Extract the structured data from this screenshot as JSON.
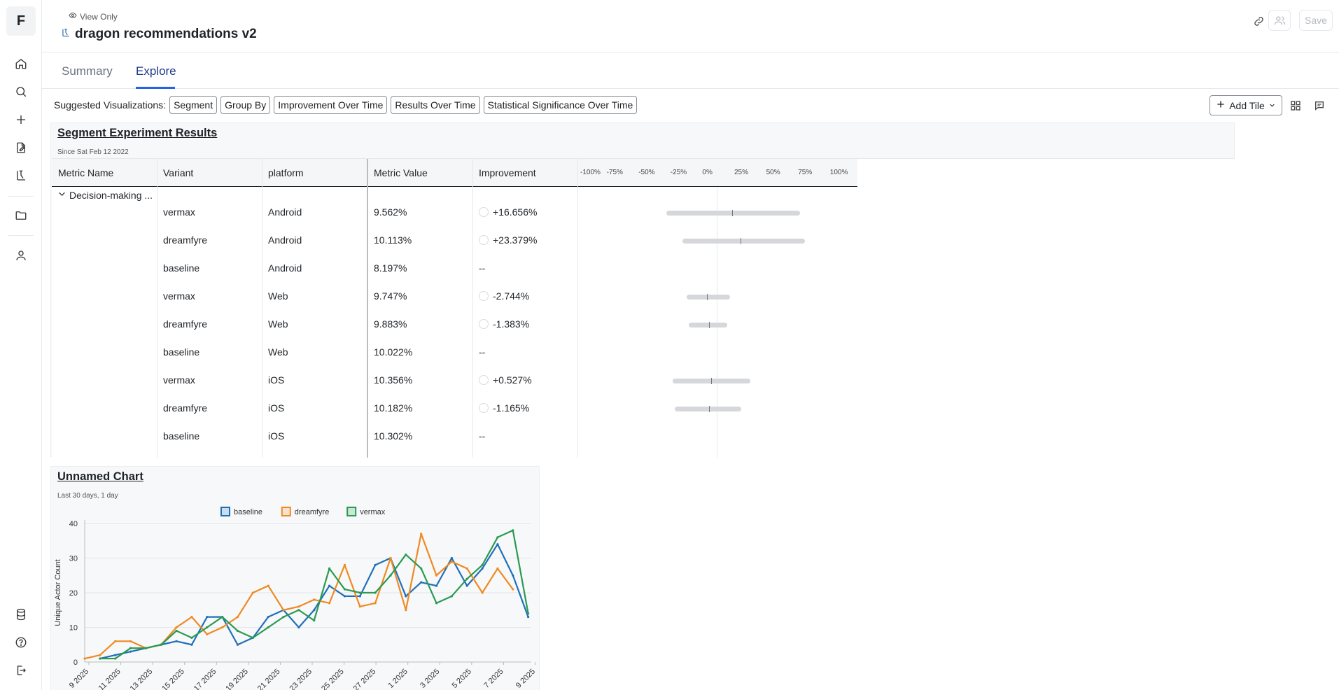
{
  "app": {
    "logo_letter": "F"
  },
  "header": {
    "view_only": "View Only",
    "title": "dragon recommendations v2",
    "save_label": "Save"
  },
  "tabs": [
    {
      "label": "Summary",
      "active": false
    },
    {
      "label": "Explore",
      "active": true
    }
  ],
  "toolbar": {
    "suggested_label": "Suggested Visualizations:",
    "chips": [
      "Segment",
      "Group By",
      "Improvement Over Time",
      "Results Over Time",
      "Statistical Significance Over Time"
    ],
    "add_tile_label": "Add Tile"
  },
  "segment_tile": {
    "title": "Segment Experiment Results",
    "subtitle": "Since Sat Feb 12 2022",
    "columns": [
      "Metric Name",
      "Variant",
      "platform",
      "Metric Value",
      "Improvement"
    ],
    "axis_ticks": [
      "-100%",
      "-75%",
      "-50%",
      "-25%",
      "0%",
      "25%",
      "50%",
      "75%",
      "100%"
    ],
    "group_label": "Decision-making ...",
    "rows": [
      {
        "variant": "vermax",
        "platform": "Android",
        "value": "9.562%",
        "improvement": "+16.656%",
        "imp_pct": 16.656,
        "ci_low": -35,
        "ci_high": 70
      },
      {
        "variant": "dreamfyre",
        "platform": "Android",
        "value": "10.113%",
        "improvement": "+23.379%",
        "imp_pct": 23.379,
        "ci_low": -22,
        "ci_high": 74
      },
      {
        "variant": "baseline",
        "platform": "Android",
        "value": "8.197%",
        "improvement": "--"
      },
      {
        "variant": "vermax",
        "platform": "Web",
        "value": "9.747%",
        "improvement": "-2.744%",
        "imp_pct": -2.744,
        "ci_low": -19,
        "ci_high": 15
      },
      {
        "variant": "dreamfyre",
        "platform": "Web",
        "value": "9.883%",
        "improvement": "-1.383%",
        "imp_pct": -1.383,
        "ci_low": -17,
        "ci_high": 13
      },
      {
        "variant": "baseline",
        "platform": "Web",
        "value": "10.022%",
        "improvement": "--"
      },
      {
        "variant": "vermax",
        "platform": "iOS",
        "value": "10.356%",
        "improvement": "+0.527%",
        "imp_pct": 0.527,
        "ci_low": -30,
        "ci_high": 31
      },
      {
        "variant": "dreamfyre",
        "platform": "iOS",
        "value": "10.182%",
        "improvement": "-1.165%",
        "imp_pct": -1.165,
        "ci_low": -28,
        "ci_high": 24
      },
      {
        "variant": "baseline",
        "platform": "iOS",
        "value": "10.302%",
        "improvement": "--"
      }
    ]
  },
  "chart_tile": {
    "title": "Unnamed Chart",
    "subtitle": "Last 30 days, 1 day"
  },
  "chart_data": {
    "type": "line",
    "ylabel": "Unique Actor Count",
    "xlabel": "",
    "ylim": [
      0,
      40
    ],
    "yticks": [
      0,
      10,
      20,
      30,
      40
    ],
    "x_tick_labels": [
      "9 2025",
      "11 2025",
      "13 2025",
      "15 2025",
      "17 2025",
      "19 2025",
      "21 2025",
      "23 2025",
      "25 2025",
      "27 2025",
      "1 2025",
      "3 2025",
      "5 2025",
      "7 2025",
      "9 2025"
    ],
    "grid": true,
    "legend_position": "top",
    "series": [
      {
        "name": "baseline",
        "color": "#1f6fb8",
        "values": [
          1,
          2,
          3,
          4,
          5,
          6,
          5,
          13,
          13,
          5,
          7,
          13,
          15,
          10,
          15,
          22,
          19,
          19,
          28,
          30,
          19,
          23,
          22,
          30,
          22,
          27,
          34,
          25,
          13
        ]
      },
      {
        "name": "dreamfyre",
        "color": "#ef8a22",
        "values": [
          1,
          2,
          6,
          6,
          4,
          5,
          10,
          13,
          8,
          10,
          13,
          20,
          22,
          15,
          16,
          18,
          17,
          28,
          16,
          17,
          30,
          15,
          37,
          25,
          29,
          27,
          20,
          27,
          21
        ]
      },
      {
        "name": "vermax",
        "color": "#2a9a4f",
        "values": [
          1,
          1,
          4,
          4,
          5,
          9,
          7,
          10,
          13,
          9,
          7,
          10,
          13,
          15,
          12,
          27,
          21,
          20,
          20,
          25,
          31,
          27,
          17,
          19,
          24,
          28,
          36,
          38,
          14
        ]
      }
    ]
  }
}
